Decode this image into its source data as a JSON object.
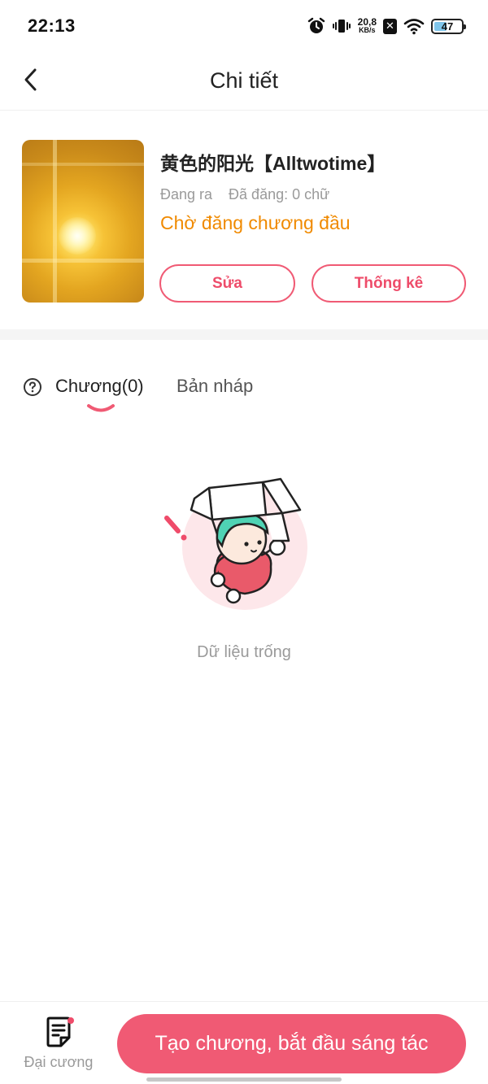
{
  "status_bar": {
    "time": "22:13",
    "net_speed_value": "20,8",
    "net_speed_unit": "KB/s",
    "battery_level": "47",
    "battery_fraction": 0.47,
    "icons": [
      "alarm-icon",
      "vibrate-icon",
      "network-speed",
      "close-box-icon",
      "wifi-icon",
      "battery-icon"
    ]
  },
  "header": {
    "title": "Chi tiết",
    "back_icon": "chevron-left-icon"
  },
  "book": {
    "title": "黄色的阳光【Alltwotime】",
    "status_label": "Đang ra",
    "word_count": "Đã đăng: 0 chữ",
    "publish_status": "Chờ đăng chương đầu",
    "edit_label": "Sửa",
    "stats_label": "Thống kê"
  },
  "tabs": {
    "help_icon": "question-circle-icon",
    "chapters_label": "Chương(0)",
    "drafts_label": "Bản nháp",
    "active": "chapters"
  },
  "empty_state": {
    "text": "Dữ liệu trống",
    "illustration": "character-holding-box"
  },
  "bottom_bar": {
    "outline_label": "Đại cương",
    "outline_icon": "document-list-icon",
    "cta_label": "Tạo chương, bắt đầu sáng tác"
  },
  "colors": {
    "accent": "#f05a74",
    "status_orange": "#f08a00",
    "muted_text": "#9a9a9a",
    "background": "#ffffff"
  }
}
